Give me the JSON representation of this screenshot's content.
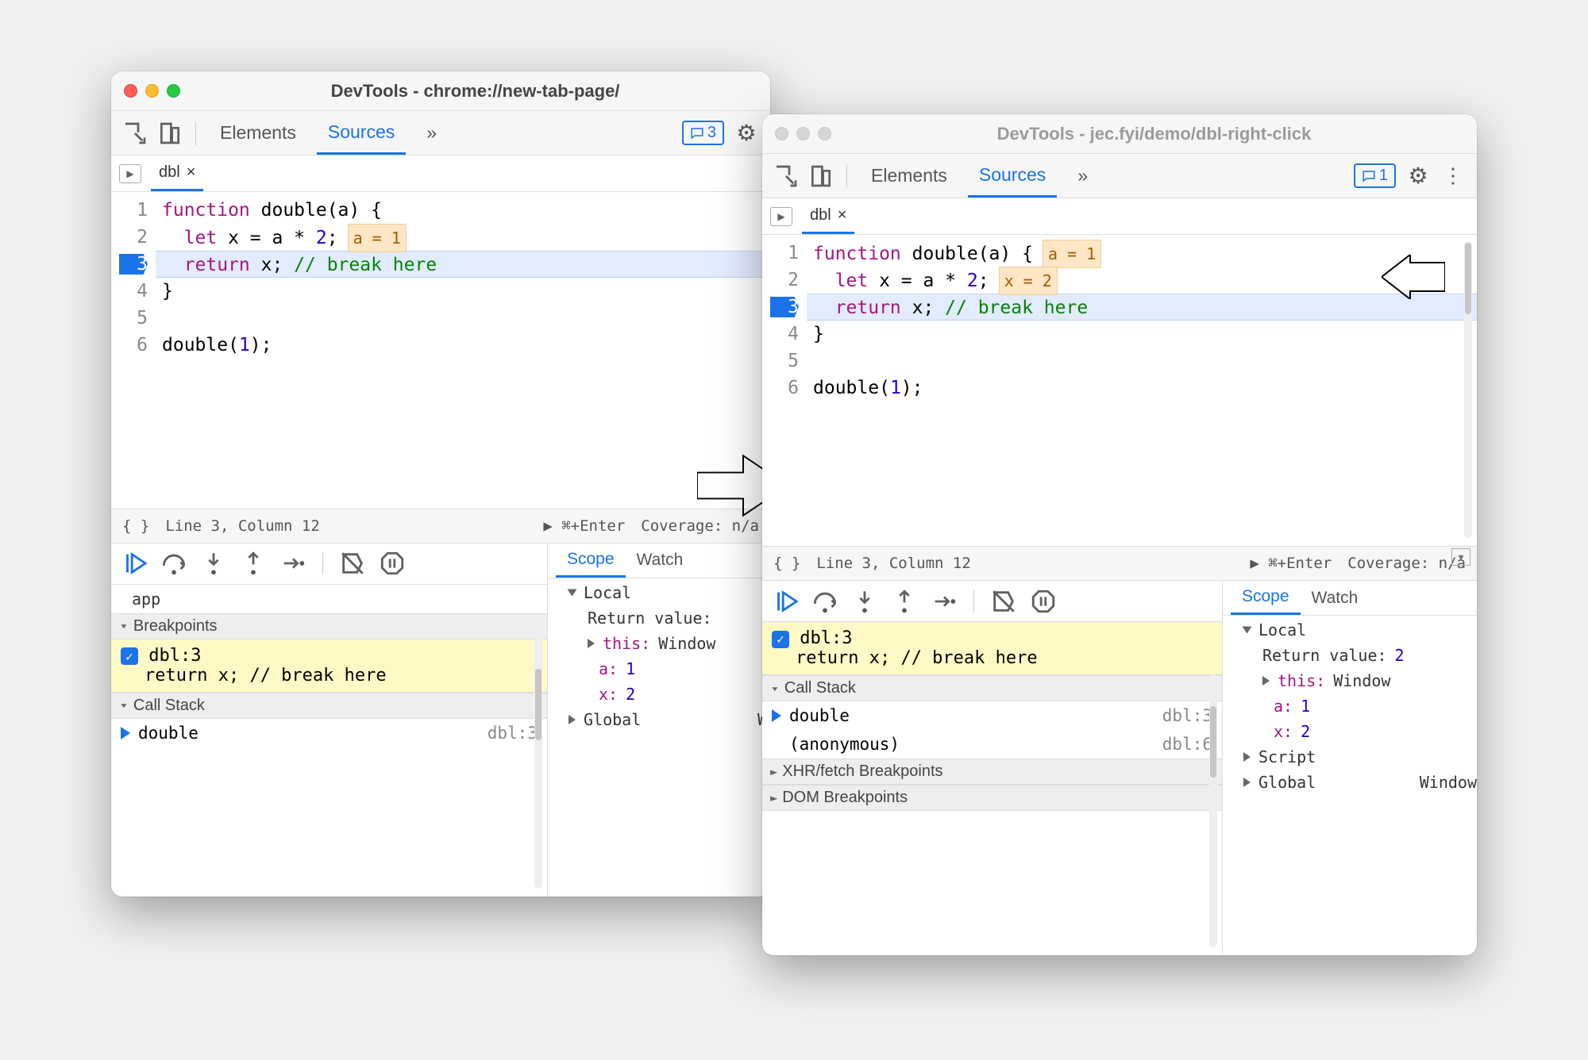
{
  "window1": {
    "title": "DevTools - chrome://new-tab-page/",
    "tabs": {
      "elements": "Elements",
      "sources": "Sources",
      "more": "»"
    },
    "issues_count": "3",
    "file_tab": "dbl",
    "code": {
      "l1a": "function",
      "l1b": " double(a) {",
      "l2a": "  let",
      "l2b": " x = a * ",
      "l2c": "2",
      "l2d": ";",
      "l2_hint": "a = 1",
      "l3a": "  return",
      "l3b": " x; ",
      "l3c": "// break here",
      "l4": "}",
      "l5": " ",
      "l6a": "double(",
      "l6b": "1",
      "l6c": ");"
    },
    "status": {
      "pos": "Line 3, Column 12",
      "run": "▶ ⌘+Enter",
      "coverage": "Coverage: n/a"
    },
    "left_sections": {
      "app_label": "app",
      "breakpoints": "Breakpoints",
      "bp_item_name": "dbl:3",
      "bp_item_code": "return x; // break here",
      "call_stack": "Call Stack",
      "frame_name": "double",
      "frame_loc": "dbl:3"
    },
    "scope": {
      "tab_scope": "Scope",
      "tab_watch": "Watch",
      "local": "Local",
      "ret_label": "Return value:",
      "this_label": "this:",
      "this_val": "Window",
      "a_label": "a:",
      "a_val": "1",
      "x_label": "x:",
      "x_val": "2",
      "global": "Global",
      "global_val": "W"
    }
  },
  "window2": {
    "title": "DevTools - jec.fyi/demo/dbl-right-click",
    "tabs": {
      "elements": "Elements",
      "sources": "Sources",
      "more": "»"
    },
    "issues_count": "1",
    "file_tab": "dbl",
    "code": {
      "l1a": "function",
      "l1b": " double(a) {",
      "l1_hint": "a = 1",
      "l2a": "  let",
      "l2b": " x = a * ",
      "l2c": "2",
      "l2d": ";",
      "l2_hint": "x = 2",
      "l3a": "  return",
      "l3b": " x; ",
      "l3c": "// break here",
      "l4": "}",
      "l5": " ",
      "l6a": "double(",
      "l6b": "1",
      "l6c": ");"
    },
    "status": {
      "pos": "Line 3, Column 12",
      "run": "▶ ⌘+Enter",
      "coverage": "Coverage: n/a"
    },
    "left_sections": {
      "bp_item_name": "dbl:3",
      "bp_item_code": "return x; // break here",
      "call_stack": "Call Stack",
      "frame1_name": "double",
      "frame1_loc": "dbl:3",
      "frame2_name": "(anonymous)",
      "frame2_loc": "dbl:6",
      "xhr": "XHR/fetch Breakpoints",
      "dom": "DOM Breakpoints"
    },
    "scope": {
      "tab_scope": "Scope",
      "tab_watch": "Watch",
      "local": "Local",
      "ret_label": "Return value:",
      "ret_val": "2",
      "this_label": "this:",
      "this_val": "Window",
      "a_label": "a:",
      "a_val": "1",
      "x_label": "x:",
      "x_val": "2",
      "script": "Script",
      "global": "Global",
      "global_val": "Window"
    }
  }
}
